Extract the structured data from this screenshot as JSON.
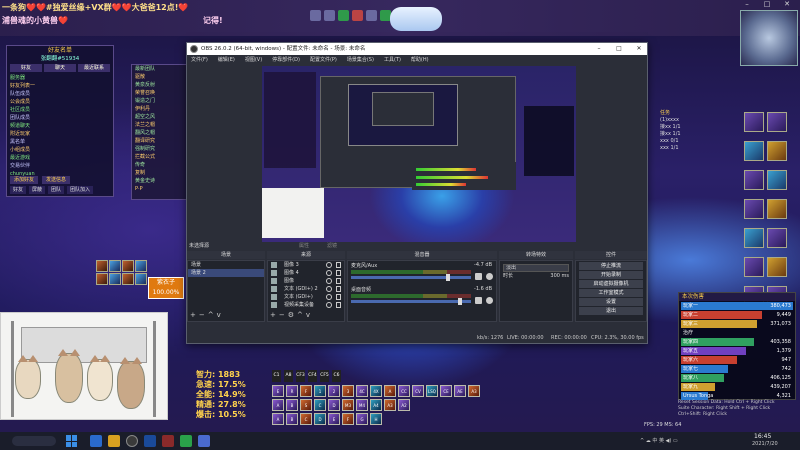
{
  "banner": {
    "line1": "一条狗❤️❤️#独爱丝缘+VX群❤️❤️大爸爸12点!❤️",
    "line2": "浦兽魂的小黄兽❤️",
    "line2_right": "记得!"
  },
  "guild_panel": {
    "title": "好友名单",
    "subtitle": "张翻翻#51934",
    "tabs": [
      "好友",
      "聊天",
      "最近联系"
    ],
    "rows": [
      "服务器",
      "好友列表一",
      "队伍成员",
      "公会成员",
      "社区成员",
      "团队成员",
      "频道聊天",
      "附近玩家",
      "黑名单",
      "小组成员",
      "最近游戏",
      "交易伙伴",
      "chunyuan",
      "cowberry",
      "zero",
      "其它玩家"
    ],
    "footer": [
      "添加好友",
      "发送信息"
    ],
    "footer2": [
      "好友",
      "屏蔽",
      "团队",
      "团队加入"
    ]
  },
  "raid_panel": {
    "rows": [
      "最新团队",
      "驱散",
      "黄泉反射",
      "荣誉召唤",
      "锻造之门",
      "伊利丹",
      "超空之风",
      "法兰之帽",
      "翻风之帽",
      "翻译研究",
      "强制研究",
      "拦截公式",
      "传奇",
      "复制",
      "黄金史诗",
      "P·P",
      "新星盟",
      "召唤回来",
      "原石选"
    ]
  },
  "quest_panel": {
    "title": "任务",
    "rows": [
      "(1)xxxx",
      "接xx 1/1",
      "接xx 1/1",
      "xxx 0/1",
      "xxx 1/1"
    ]
  },
  "damage_meter": {
    "title": "本次伤害",
    "rows": [
      {
        "name": "玩家一",
        "value": "380,473",
        "pct": 1.0,
        "color": "#2a7ad0"
      },
      {
        "name": "玩家二",
        "value": "9,449",
        "pct": 0.72,
        "color": "#c84030"
      },
      {
        "name": "玩家三",
        "value": "371,073",
        "pct": 0.68,
        "color": "#d0a030"
      },
      {
        "name": "治疗",
        "value": "",
        "pct": 0.0,
        "color": "#333"
      },
      {
        "name": "玩家四",
        "value": "403,358",
        "pct": 0.65,
        "color": "#30a060"
      },
      {
        "name": "玩家五",
        "value": "1,379",
        "pct": 0.58,
        "color": "#7040c0"
      },
      {
        "name": "玩家六",
        "value": "947",
        "pct": 0.5,
        "color": "#c84030"
      },
      {
        "name": "玩家七",
        "value": "742",
        "pct": 0.42,
        "color": "#2a7ad0"
      },
      {
        "name": "玩家八",
        "value": "406,125",
        "pct": 0.38,
        "color": "#30a060"
      },
      {
        "name": "玩家九",
        "value": "439,207",
        "pct": 0.3,
        "color": "#d0a030"
      },
      {
        "name": "Ursus Tonga",
        "value": "4,321",
        "pct": 0.24,
        "color": "#2a7ad0"
      }
    ],
    "footer": [
      "Reset Session Data: Hold Ctrl + Right Click",
      "Suite Character: Right Shift + Right Click",
      "Ctrl+Shift: Right Click"
    ]
  },
  "player_stats": [
    {
      "label": "智力",
      "value": "1883"
    },
    {
      "label": "急速",
      "value": "17.5%"
    },
    {
      "label": "全能",
      "value": "14.9%"
    },
    {
      "label": "精通",
      "value": "27.8%"
    },
    {
      "label": "爆击",
      "value": "10.5%"
    }
  ],
  "unit_frame": {
    "name": "紫衣子",
    "pct": "100.00%"
  },
  "action_bars": {
    "buffs": [
      "C1",
      "A8",
      "CF3",
      "CF4",
      "CF5",
      "C6"
    ],
    "row1": [
      "E",
      "R",
      "F",
      "1",
      "2",
      "3",
      "4C",
      "4X",
      "A",
      "CC",
      "CV",
      "LSQ",
      "CE",
      "AE",
      "A3"
    ],
    "row2": [
      "A",
      "B",
      "S",
      "C",
      "D",
      "M3",
      "M4",
      "A4",
      "A3",
      "A2"
    ],
    "row3": [
      "A",
      "B",
      "C",
      "D",
      "E",
      "F",
      "G",
      "H"
    ]
  },
  "obs": {
    "title": "OBS 26.0.2 (64-bit, windows) - 配置文件: 未命名 - 场景: 未命名",
    "menu": [
      "文件(F)",
      "编辑(E)",
      "视图(V)",
      "停靠部件(D)",
      "配置文件(P)",
      "场景集合(S)",
      "工具(T)",
      "帮助(H)"
    ],
    "scene_filter": {
      "scene": "未选择源",
      "properties": "属性",
      "filters": "滤镜"
    },
    "docks": {
      "scenes": {
        "header": "场景",
        "items": [
          "场景",
          "场景 2"
        ]
      },
      "sources": {
        "header": "来源",
        "items": [
          "图像 3",
          "图像 4",
          "图像",
          "文本 (GDI+) 2",
          "文本 (GDI+)",
          "视频采集设备"
        ]
      },
      "mixer": {
        "header": "混音器",
        "channels": [
          {
            "name": "麦克风/Aux",
            "db": "-4.7 dB",
            "knob": 0.82
          },
          {
            "name": "桌面音频",
            "db": "-1.6 dB",
            "knob": 0.92
          }
        ]
      },
      "transitions": {
        "header": "转场特效",
        "select": "淡出",
        "duration_label": "时长",
        "duration": "300 ms"
      },
      "controls": {
        "header": "控件",
        "buttons": [
          "停止推流",
          "开始录制",
          "启动虚拟摄像机",
          "工作室模式",
          "设置",
          "退出"
        ]
      }
    },
    "status": {
      "live": "LIVE: 00:00:00",
      "rec": "REC: 00:00:00",
      "cpu": "CPU: 2.3%, 30.00 fps",
      "kbps": "kb/s: 1276"
    }
  },
  "fps_line": "FPS: 29  MS: 64",
  "taskbar": {
    "time": "16:45",
    "date": "2021/7/20",
    "tray": "^  ☁  中  英  ◀)  ▭"
  },
  "window_controls": {
    "minimize": "–",
    "maximize": "□",
    "close": "✕"
  }
}
